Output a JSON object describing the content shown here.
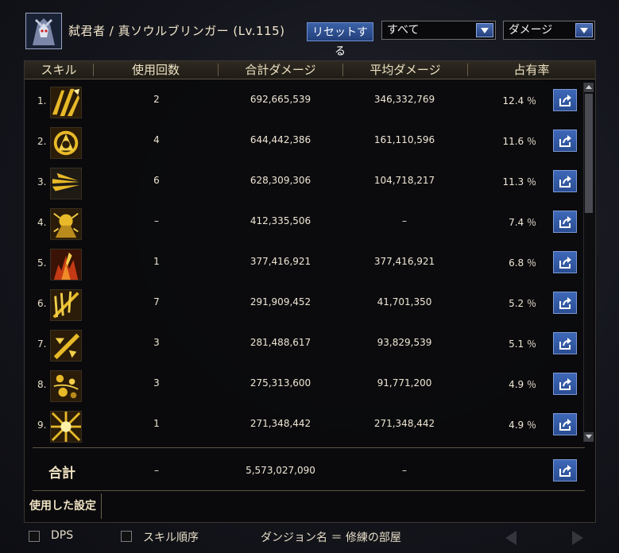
{
  "header": {
    "character_name": "弑君者 / 真ソウルブリンガー (Lv.115)",
    "reset_label": "リセットする",
    "filter_select": "すべて",
    "metric_select": "ダメージ"
  },
  "table": {
    "columns": [
      "スキル",
      "使用回数",
      "合計ダメージ",
      "平均ダメージ",
      "占有率"
    ],
    "rows": [
      {
        "rank": "1.",
        "icon": "skill-icon-1",
        "uses": "2",
        "total": "692,665,539",
        "avg": "346,332,769",
        "share": "12.4 ％"
      },
      {
        "rank": "2.",
        "icon": "skill-icon-2",
        "uses": "4",
        "total": "644,442,386",
        "avg": "161,110,596",
        "share": "11.6 ％"
      },
      {
        "rank": "3.",
        "icon": "skill-icon-3",
        "uses": "6",
        "total": "628,309,306",
        "avg": "104,718,217",
        "share": "11.3 ％"
      },
      {
        "rank": "4.",
        "icon": "skill-icon-4",
        "uses": "–",
        "total": "412,335,506",
        "avg": "–",
        "share": "7.4 ％"
      },
      {
        "rank": "5.",
        "icon": "skill-icon-5",
        "uses": "1",
        "total": "377,416,921",
        "avg": "377,416,921",
        "share": "6.8 ％"
      },
      {
        "rank": "6.",
        "icon": "skill-icon-6",
        "uses": "7",
        "total": "291,909,452",
        "avg": "41,701,350",
        "share": "5.2 ％"
      },
      {
        "rank": "7.",
        "icon": "skill-icon-7",
        "uses": "3",
        "total": "281,488,617",
        "avg": "93,829,539",
        "share": "5.1 ％"
      },
      {
        "rank": "8.",
        "icon": "skill-icon-8",
        "uses": "3",
        "total": "275,313,600",
        "avg": "91,771,200",
        "share": "4.9 ％"
      },
      {
        "rank": "9.",
        "icon": "skill-icon-9",
        "uses": "1",
        "total": "271,348,442",
        "avg": "271,348,442",
        "share": "4.9 ％"
      }
    ]
  },
  "totals": {
    "label": "合計",
    "uses": "–",
    "total": "5,573,027,090",
    "avg": "–"
  },
  "settings_label": "使用した設定",
  "footer": {
    "dps_label": "DPS",
    "skill_order_label": "スキル順序",
    "dungeon_text": "ダンジョン名 ＝ 修練の部屋"
  },
  "colors": {
    "accent_blue": "#2f56a4",
    "icon_gold": "#e8b928",
    "icon_dark": "#2a1c08",
    "icon_red": "#c43a14"
  }
}
